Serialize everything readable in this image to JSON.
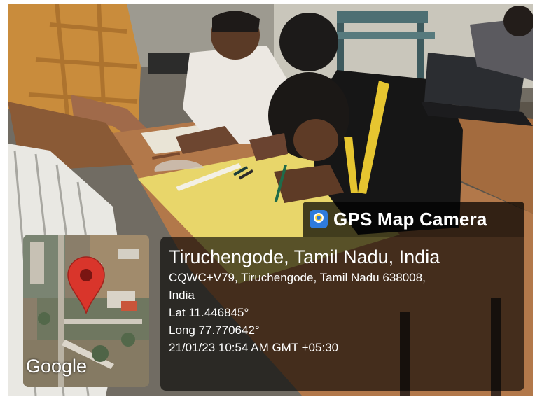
{
  "badge": {
    "title": "GPS Map Camera",
    "logo_icon": "gps-map-camera-logo-icon"
  },
  "info": {
    "location": "Tiruchengode, Tamil Nadu, India",
    "address_line1": "CQWC+V79, Tiruchengode, Tamil Nadu 638008,",
    "address_line2": "India",
    "lat": "Lat 11.446845°",
    "long": "Long 77.770642°",
    "datetime": "21/01/23 10:54 AM GMT +05:30"
  },
  "map": {
    "attribution": "Google",
    "pin_icon": "map-pin-icon",
    "pin_color": "#d9352b"
  },
  "colors": {
    "overlay": "#000000",
    "chart_paper": "#e8d66a",
    "desk_wood": "#b2784a"
  }
}
